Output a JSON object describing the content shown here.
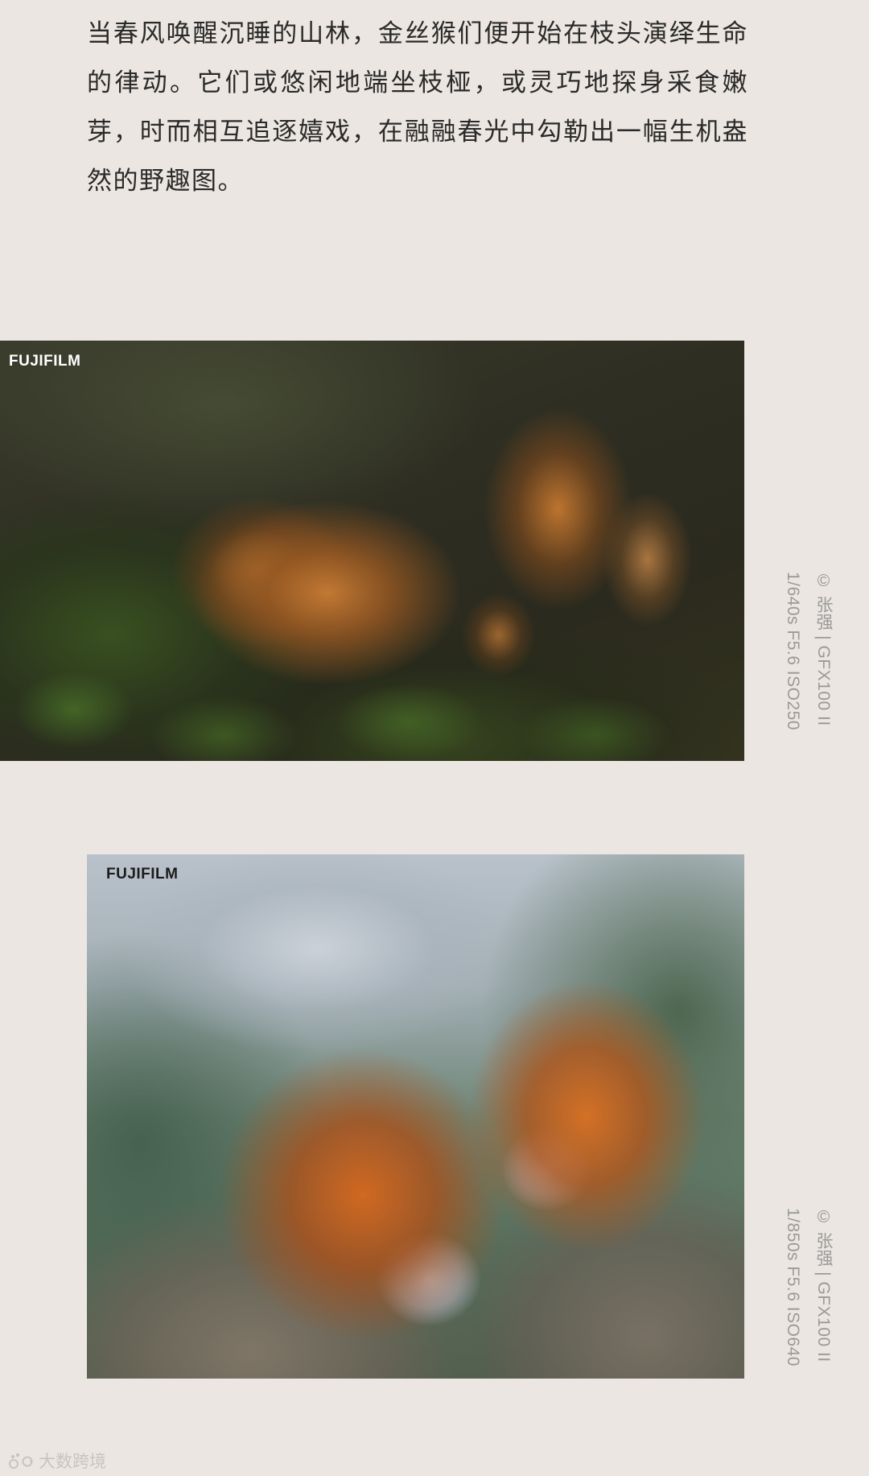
{
  "intro": {
    "text": "当春风唤醒沉睡的山林，金丝猴们便开始在枝头演绎生命的律动。它们或悠闲地端坐枝桠，或灵巧地探身采食嫩芽，时而相互追逐嬉戏，在融融春光中勾勒出一幅生机盎然的野趣图。"
  },
  "photos": [
    {
      "brand": "FUJIFILM",
      "caption_credit": "© 张强 | GFX100 II",
      "caption_exif": "1/640s F5.6 ISO250"
    },
    {
      "brand": "FUJIFILM",
      "caption_credit": "© 张强 | GFX100 II",
      "caption_exif": "1/850s F5.6 ISO640"
    }
  ],
  "source": {
    "logo_icon": "paw-logo-icon",
    "text": "大数跨境"
  }
}
